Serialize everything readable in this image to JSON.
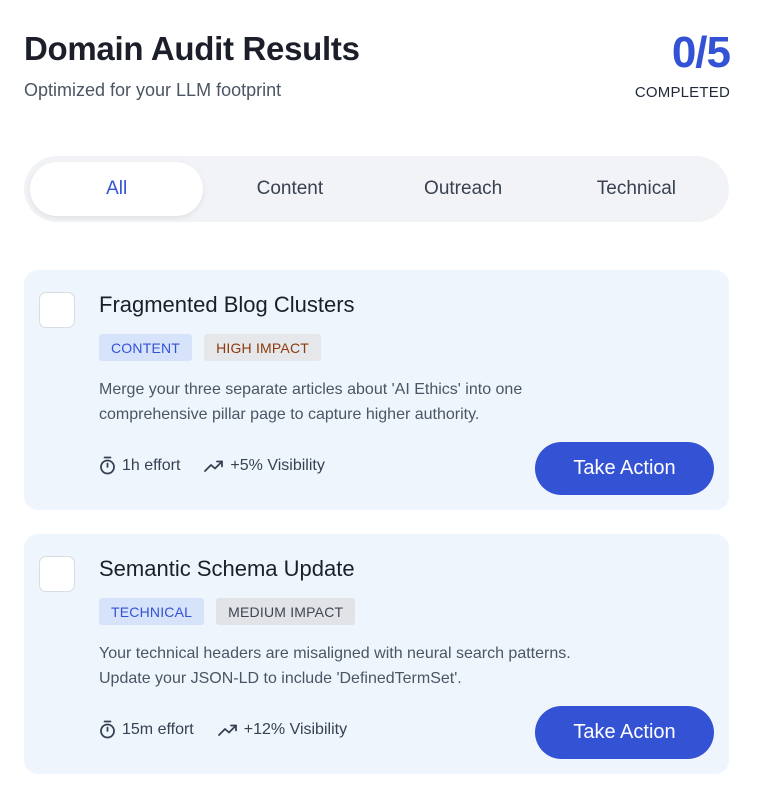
{
  "header": {
    "title": "Domain Audit Results",
    "subtitle": "Optimized for your LLM footprint"
  },
  "progress": {
    "value": "0/5",
    "label": "COMPLETED",
    "completed": 0,
    "total": 5
  },
  "tabs": [
    {
      "label": "All",
      "active": true
    },
    {
      "label": "Content",
      "active": false
    },
    {
      "label": "Outreach",
      "active": false
    },
    {
      "label": "Technical",
      "active": false
    }
  ],
  "tasks": [
    {
      "title": "Fragmented Blog Clusters",
      "category": "CONTENT",
      "impact": "HIGH IMPACT",
      "description": "Merge your three separate articles about 'AI Ethics' into one comprehensive pillar page to capture higher authority.",
      "effort": "1h effort",
      "visibility": "+5% Visibility",
      "action_label": "Take Action",
      "checked": false
    },
    {
      "title": "Semantic Schema Update",
      "category": "TECHNICAL",
      "impact": "MEDIUM IMPACT",
      "description": "Your technical headers are misaligned with neural search patterns. Update your JSON-LD to include 'DefinedTermSet'.",
      "effort": "15m effort",
      "visibility": "+12% Visibility",
      "action_label": "Take Action",
      "checked": false
    }
  ],
  "colors": {
    "accent": "#3452d4",
    "card_bg": "#eef5fd",
    "tab_bg": "#f1f3f6",
    "high_impact_text": "#8a3a0c"
  },
  "icons": {
    "effort": "stopwatch-icon",
    "visibility": "trending-up-icon"
  }
}
